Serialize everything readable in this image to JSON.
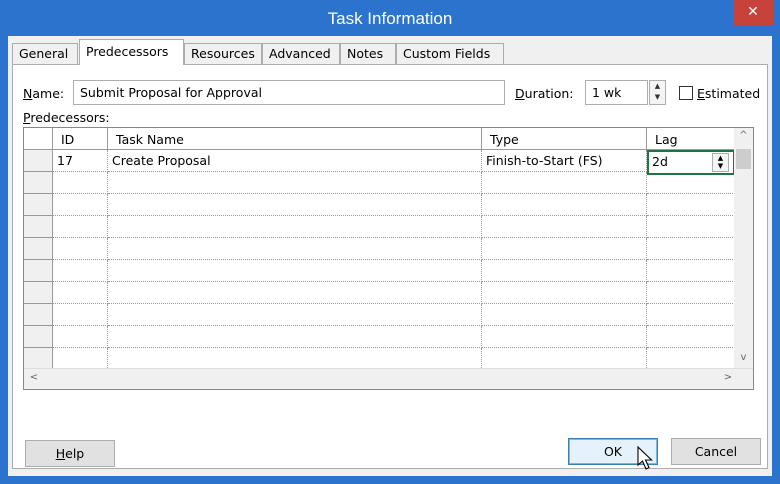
{
  "window": {
    "title": "Task Information",
    "close_glyph": "✕"
  },
  "tabs": [
    {
      "label": "General"
    },
    {
      "label": "Predecessors",
      "active": true
    },
    {
      "label": "Resources"
    },
    {
      "label": "Advanced"
    },
    {
      "label": "Notes"
    },
    {
      "label": "Custom Fields"
    }
  ],
  "form": {
    "name_label_key": "N",
    "name_label_rest": "ame:",
    "name_value": "Submit Proposal for Approval",
    "duration_label_key": "D",
    "duration_label_rest": "uration:",
    "duration_value": "1 wk",
    "estimated_label_key": "E",
    "estimated_label_rest": "stimated",
    "estimated_checked": false,
    "predecessors_label_key": "P",
    "predecessors_label_rest": "redecessors:"
  },
  "grid": {
    "columns": [
      "ID",
      "Task Name",
      "Type",
      "Lag"
    ],
    "rows": [
      {
        "id": "17",
        "task_name": "Create Proposal",
        "type": "Finish-to-Start (FS)",
        "lag": "2d"
      }
    ]
  },
  "buttons": {
    "help_key": "H",
    "help_rest": "elp",
    "ok": "OK",
    "cancel": "Cancel"
  },
  "icons": {
    "scroll_up": "^",
    "scroll_down": "v",
    "scroll_left": "<",
    "scroll_right": ">"
  },
  "colors": {
    "titlebar": "#2b73cc",
    "close": "#c7423a",
    "edit_border": "#217346"
  }
}
